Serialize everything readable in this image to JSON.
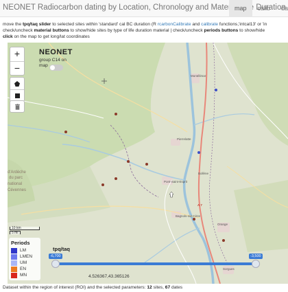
{
  "header": {
    "title": "NEONET Radiocarbon dating by Location, Chronology and Material Life Duration",
    "tabs": [
      {
        "label": "map",
        "active": true
      },
      {
        "label": "calib",
        "active": false
      },
      {
        "label": "data",
        "active": false
      }
    ]
  },
  "description": {
    "l1_a": "move the ",
    "l1_b": "tpq/taq slider",
    "l1_c": " to selected sites within 'standard' cal BC duration (R ",
    "l1_link1": "rcarbon",
    "l1_link1b": "Calibrate",
    "l1_d": " and ",
    "l1_link2": "calibrate",
    "l1_e": " functions,'intcal13' or 'in",
    "l2_a": "check/uncheck ",
    "l2_b": "material buttons",
    "l2_c": " to show/hide sites by type of life duration material | check/uncheck ",
    "l2_d": "periods buttons",
    "l2_e": " to show/hide",
    "l3_a": "click",
    "l3_b": " on the map to get long/lat coordinates"
  },
  "map": {
    "logo": "NEONET",
    "group_toggle_label": "group C14 on map",
    "group_toggle_on": false,
    "zoom_in": "+",
    "zoom_out": "−",
    "scale": {
      "km": "10 km",
      "mi": "5 mi"
    },
    "places": [
      {
        "name": "Montélimar"
      },
      {
        "name": "Pierrelatte"
      },
      {
        "name": "Bollène"
      },
      {
        "name": "Pont-Saint-Esprit"
      },
      {
        "name": "Bagnols-sur-Cèze"
      },
      {
        "name": "Orange"
      },
      {
        "name": "Sorgues"
      },
      {
        "name": "d'Ardèche"
      },
      {
        "name": "du parc"
      },
      {
        "name": "national"
      },
      {
        "name": "Cévennes"
      },
      {
        "name": "A 7"
      }
    ],
    "coords": "4.526367,43.365126"
  },
  "legend": {
    "title": "Periods",
    "items": [
      {
        "code": "LM",
        "color": "#2f37c9"
      },
      {
        "code": "LMEN",
        "color": "#6c78ee"
      },
      {
        "code": "UM",
        "color": "#a9b6f6"
      },
      {
        "code": "EN",
        "color": "#ec7a22"
      },
      {
        "code": "MN",
        "color": "#d9261c"
      }
    ]
  },
  "slider": {
    "label": "tpq/taq",
    "min_label": "-6,700",
    "max_label": "-3,500",
    "min_frac": 0.0,
    "max_frac": 1.0,
    "color": "#3a7bd5"
  },
  "status": {
    "prefix": "Dataset within the region of interest (ROI) and the selected parameters: ",
    "sites": "12",
    "sites_word": " sites, ",
    "dates": "67",
    "dates_word": " dates"
  }
}
